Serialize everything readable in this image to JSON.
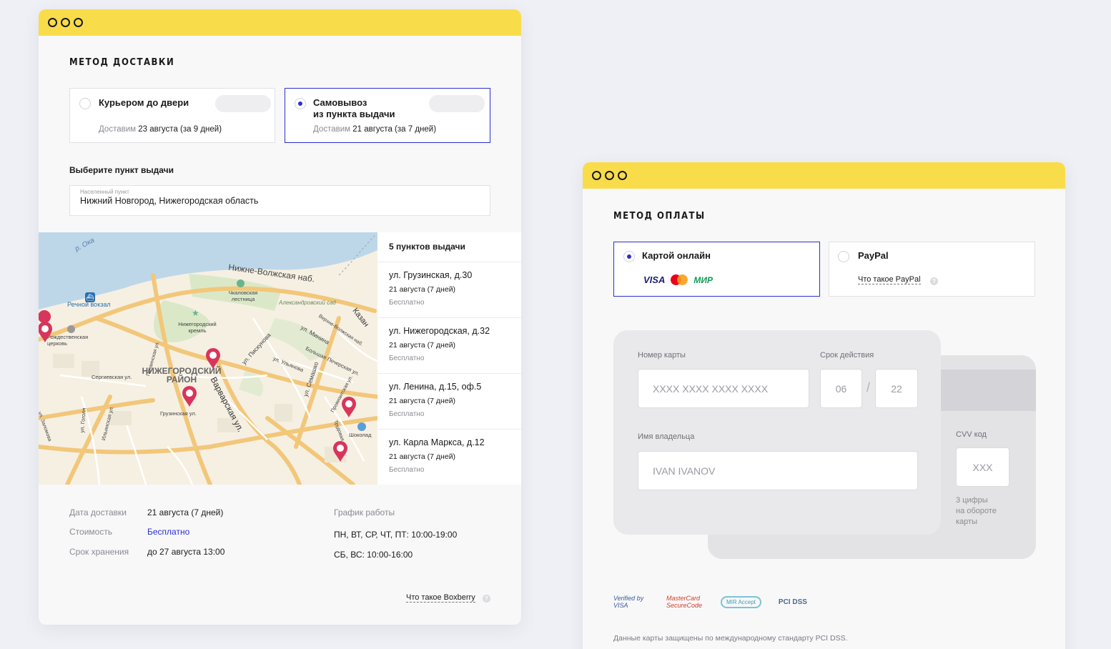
{
  "delivery": {
    "title": "МЕТОД ДОСТАВКИ",
    "options": [
      {
        "title": "Курьером до двери",
        "sub_muted": "Доставим",
        "sub_value": "23 августа (за 9 дней)",
        "selected": false
      },
      {
        "title_line1": "Самовывоз",
        "title_line2": "из пункта выдачи",
        "sub_muted": "Доставим",
        "sub_value": "21 августа (за 7 дней)",
        "selected": true
      }
    ],
    "pickup_label": "Выберите пункт выдачи",
    "city_caption": "Населенный пункт",
    "city_value": "Нижний Новгород, Нижегородская область",
    "points_header": "5 пунктов выдачи",
    "points": [
      {
        "address": "ул. Грузинская, д.30",
        "date": "21 августа (7 дней)",
        "price": "Бесплатно"
      },
      {
        "address": "ул. Нижегородская, д.32",
        "date": "21 августа (7 дней)",
        "price": "Бесплатно"
      },
      {
        "address": "ул. Ленина, д.15, оф.5",
        "date": "21 августа (7 дней)",
        "price": "Бесплатно"
      },
      {
        "address": "ул. Карла Маркса, д.12",
        "date": "21 августа (7 дней)",
        "price": "Бесплатно"
      }
    ],
    "map_labels": {
      "river": "р. Ока",
      "naberezhnaya": "Нижне-Волжская наб.",
      "rechnoy": "Речной вокзал",
      "chkalov": "Чкаловская лестница",
      "aleks": "Александровский сад",
      "kreml": "Нижегородский кремль",
      "rozhd": "Рождественская церковь",
      "rayon": "НИЖЕГОРОДСКИЙ РАЙОН",
      "varvar": "Варварская ул.",
      "piskunova": "ул. Пискунова",
      "minina": "ул. Минина",
      "semashko": "ул. Семашко",
      "sergievskaya": "Сергиевская ул.",
      "gruzinskaya": "Грузинская ул.",
      "shokolad": "Шоколад",
      "kazan": "Казан",
      "ulyanova": "ул. Ульянова",
      "pechora": "Большая Печерская ул.",
      "verkhne": "Верхне-Волжская наб.",
      "ilinskaya": "Ильинская ул.",
      "gogolya": "ул. Гоголя",
      "pochain": "Почаинская ул.",
      "zalomova": "ул. Заломова",
      "trudovaya": "Трудовая",
      "prov": "Провиантская ул."
    },
    "info": {
      "date_key": "Дата доставки",
      "date_val": "21 августа (7 дней)",
      "cost_key": "Стоимость",
      "cost_val": "Бесплатно",
      "store_key": "Срок хранения",
      "store_val": "до 27 августа 13:00",
      "schedule_key": "График работы",
      "schedule_1": "ПН, ВТ, СР, ЧТ, ПТ: 10:00-19:00",
      "schedule_2": "СБ, ВС: 10:00-16:00"
    },
    "help_link": "Что такое Boxberry"
  },
  "payment": {
    "title": "МЕТОД ОПЛАТЫ",
    "options": [
      {
        "title": "Картой онлайн",
        "selected": true,
        "logos": [
          "VISA",
          "MasterCard",
          "МИР"
        ]
      },
      {
        "title": "PayPal",
        "selected": false,
        "help": "Что такое PayPal"
      }
    ],
    "card": {
      "number_caption": "Номер карты",
      "number_placeholder": "XXXX XXXX XXXX XXXX",
      "expiry_caption": "Срок действия",
      "month": "06",
      "separator": "/",
      "year": "22",
      "holder_caption": "Имя владельца",
      "holder_placeholder": "IVAN IVANOV",
      "cvv_caption": "CVV код",
      "cvv_placeholder": "XXX",
      "cvv_hint_1": "3 цифры",
      "cvv_hint_2": "на обороте",
      "cvv_hint_3": "карты"
    },
    "security_logos": [
      "Verified by VISA",
      "MasterCard SecureCode",
      "MIR Accept",
      "PCI DSS"
    ],
    "footnote": "Данные карты защищены по международному стандарту PCI DSS."
  },
  "colors": {
    "accent": "#2b2fd1",
    "bar": "#f9dc4a",
    "pin": "#d8355a"
  }
}
